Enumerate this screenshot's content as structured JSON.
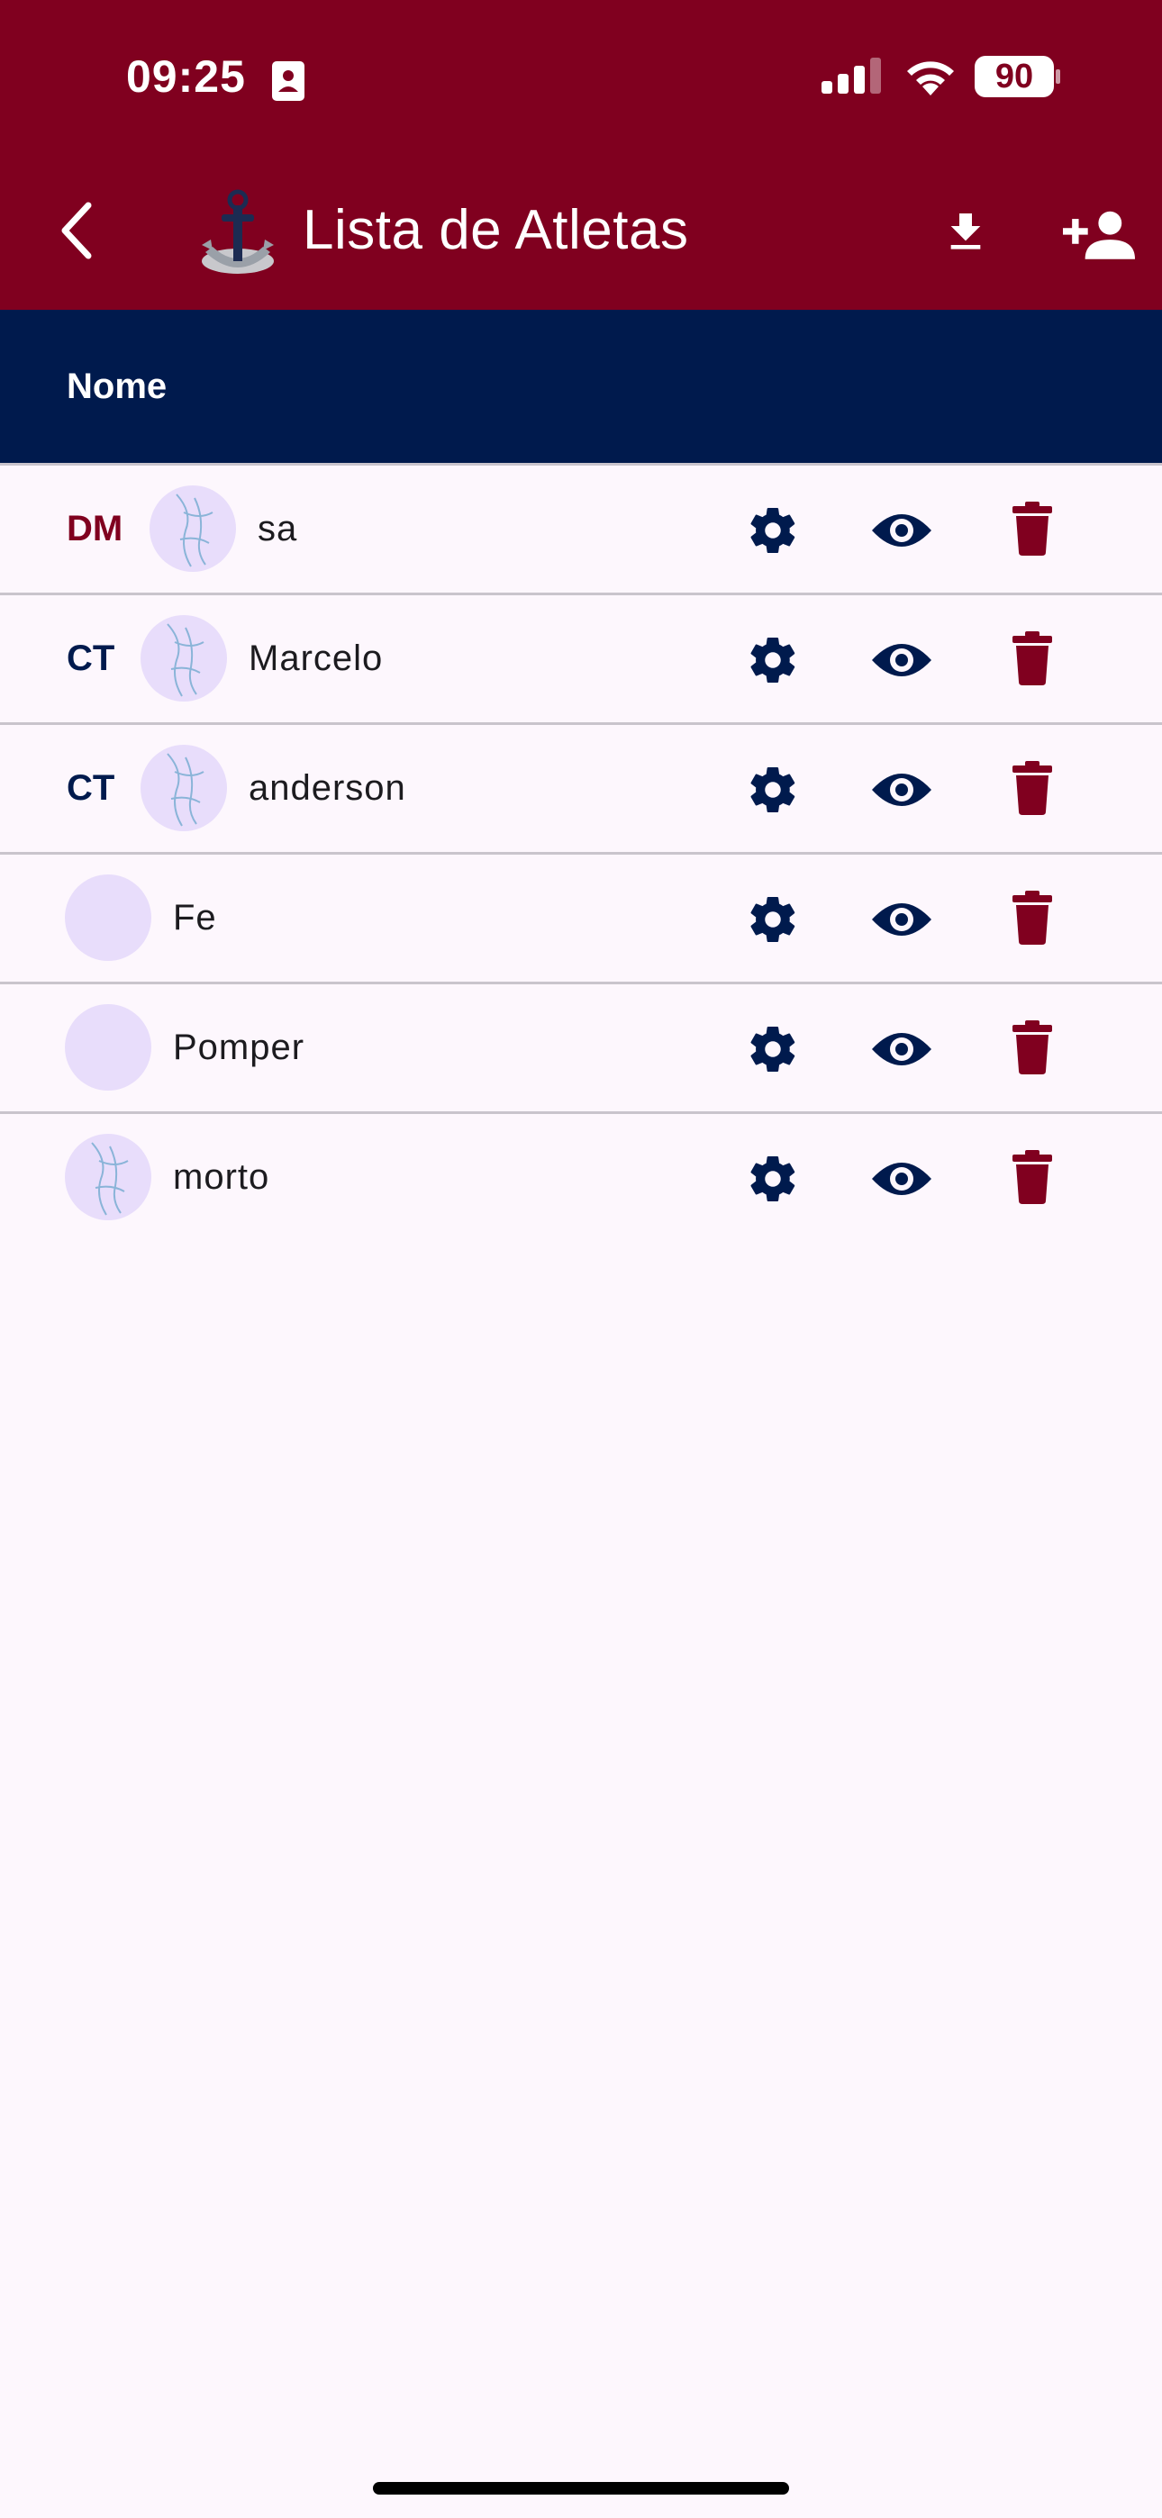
{
  "status_bar": {
    "time": "09:25",
    "battery": "90",
    "icons": [
      "contact-card-icon",
      "signal-icon",
      "wifi-icon",
      "battery-icon"
    ]
  },
  "app_bar": {
    "title": "Lista de Atletas",
    "icons": [
      "back-arrow-icon",
      "anchor-logo",
      "download-icon",
      "add-person-icon"
    ]
  },
  "table": {
    "column_name": "Nome"
  },
  "athletes": [
    {
      "badge": "DM",
      "badge_color": "#80001f",
      "name": "sa",
      "avatar": "sketch"
    },
    {
      "badge": "CT",
      "badge_color": "#001a4d",
      "name": "Marcelo",
      "avatar": "sketch"
    },
    {
      "badge": "CT",
      "badge_color": "#001a4d",
      "name": "anderson",
      "avatar": "sketch"
    },
    {
      "badge": "",
      "name": "Fe",
      "avatar": "empty"
    },
    {
      "badge": "",
      "name": "Pomper",
      "avatar": "empty"
    },
    {
      "badge": "",
      "name": "morto",
      "avatar": "sketch"
    }
  ],
  "row_actions": [
    "settings-icon",
    "view-icon",
    "delete-icon"
  ],
  "colors": {
    "primary": "#80001f",
    "navy": "#001a4d",
    "background": "#fdf7fd",
    "avatar_bg": "#e8ddfb"
  }
}
